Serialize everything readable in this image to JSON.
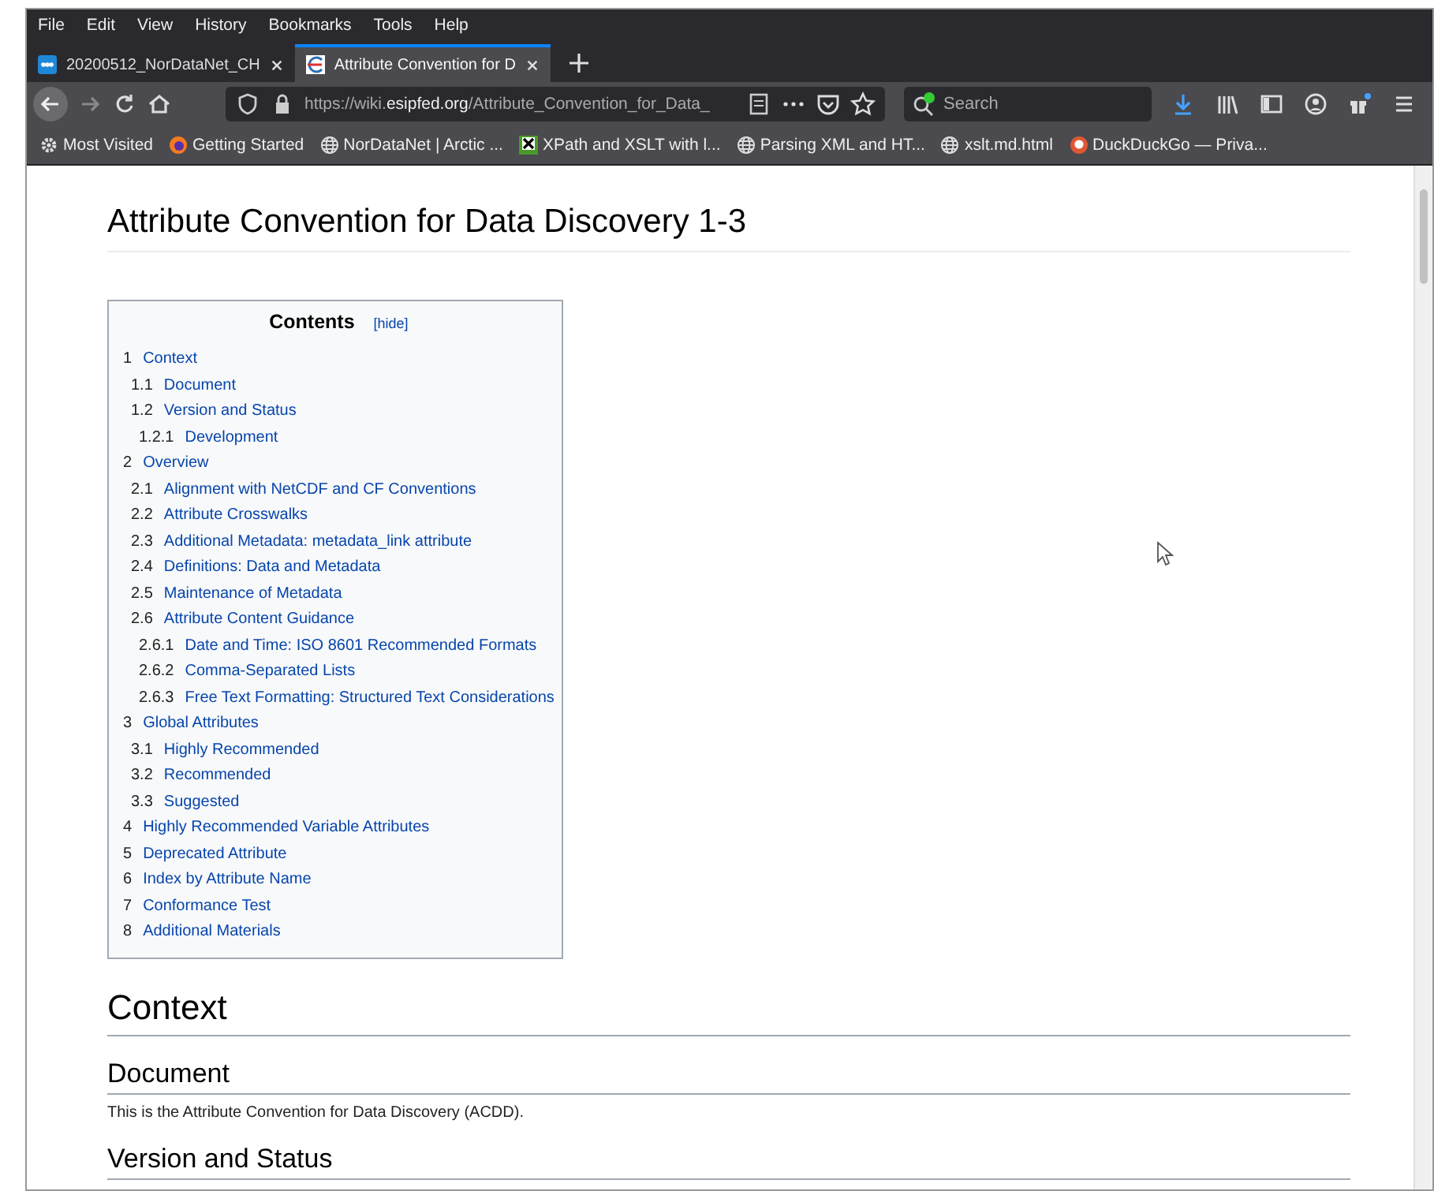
{
  "menu_bar": [
    "File",
    "Edit",
    "View",
    "History",
    "Bookmarks",
    "Tools",
    "Help"
  ],
  "tabs": [
    {
      "title": "20200512_NorDataNet_CH",
      "kind": "nordata",
      "selected": false
    },
    {
      "title": "Attribute Convention for D",
      "kind": "esip",
      "selected": true
    }
  ],
  "address_bar": {
    "url_prefix": "https://wiki.",
    "url_domain": "esipfed.org",
    "url_path": "/Attribute_Convention_for_Data_"
  },
  "search": {
    "placeholder": "Search"
  },
  "bookmarks": [
    {
      "label": "Most Visited",
      "kind": "gear"
    },
    {
      "label": "Getting Started",
      "kind": "firefox"
    },
    {
      "label": "NorDataNet | Arctic ...",
      "kind": "globe"
    },
    {
      "label": "XPath and XSLT with l...",
      "kind": "xslt"
    },
    {
      "label": "Parsing XML and HT...",
      "kind": "globe"
    },
    {
      "label": "xslt.md.html",
      "kind": "globe"
    },
    {
      "label": "DuckDuckGo — Priva...",
      "kind": "duck"
    }
  ],
  "page": {
    "title": "Attribute Convention for Data Discovery 1-3",
    "toc": {
      "heading": "Contents",
      "toggle": "[hide]",
      "items": [
        {
          "number": "1",
          "title": "Context",
          "children": [
            {
              "number": "1.1",
              "title": "Document"
            },
            {
              "number": "1.2",
              "title": "Version and Status",
              "children": [
                {
                  "number": "1.2.1",
                  "title": "Development"
                }
              ]
            }
          ]
        },
        {
          "number": "2",
          "title": "Overview",
          "children": [
            {
              "number": "2.1",
              "title": "Alignment with NetCDF and CF Conventions"
            },
            {
              "number": "2.2",
              "title": "Attribute Crosswalks"
            },
            {
              "number": "2.3",
              "title": "Additional Metadata: metadata_link attribute"
            },
            {
              "number": "2.4",
              "title": "Definitions: Data and Metadata"
            },
            {
              "number": "2.5",
              "title": "Maintenance of Metadata"
            },
            {
              "number": "2.6",
              "title": "Attribute Content Guidance",
              "children": [
                {
                  "number": "2.6.1",
                  "title": "Date and Time: ISO 8601 Recommended Formats"
                },
                {
                  "number": "2.6.2",
                  "title": "Comma-Separated Lists"
                },
                {
                  "number": "2.6.3",
                  "title": "Free Text Formatting: Structured Text Considerations"
                }
              ]
            }
          ]
        },
        {
          "number": "3",
          "title": "Global Attributes",
          "children": [
            {
              "number": "3.1",
              "title": "Highly Recommended"
            },
            {
              "number": "3.2",
              "title": "Recommended"
            },
            {
              "number": "3.3",
              "title": "Suggested"
            }
          ]
        },
        {
          "number": "4",
          "title": "Highly Recommended Variable Attributes"
        },
        {
          "number": "5",
          "title": "Deprecated Attribute"
        },
        {
          "number": "6",
          "title": "Index by Attribute Name"
        },
        {
          "number": "7",
          "title": "Conformance Test"
        },
        {
          "number": "8",
          "title": "Additional Materials"
        }
      ]
    },
    "sections": [
      {
        "kind": "h1",
        "text": "Context"
      },
      {
        "kind": "h2",
        "text": "Document"
      },
      {
        "kind": "p",
        "text": "This is the Attribute Convention for Data Discovery (ACDD)."
      },
      {
        "kind": "h2",
        "text": "Version and Status"
      }
    ]
  }
}
